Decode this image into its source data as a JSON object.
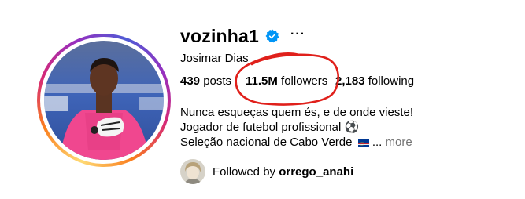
{
  "profile": {
    "username": "vozinha1",
    "full_name": "Josimar Dias",
    "verified_icon": "verified-badge-icon",
    "more_icon": "···"
  },
  "stats": {
    "posts_count": "439",
    "posts_label": "posts",
    "followers_count": "11.5M",
    "followers_label": "followers",
    "following_count": "2,183",
    "following_label": "following"
  },
  "bio": {
    "line1": "Nunca esqueças quem és, e de onde vieste!",
    "line2": "Jogador de futebol profissional ⚽",
    "line3": "Seleção nacional de Cabo Verde",
    "flag_icon": "cape-verde-flag-icon",
    "ellipsis": "...",
    "more_label": "more"
  },
  "followed_by": {
    "prefix": "Followed by",
    "username": "orrego_anahi"
  },
  "colors": {
    "verified_blue": "#0095f6",
    "annotation_red": "#e0201b",
    "muted_gray": "#737373"
  }
}
